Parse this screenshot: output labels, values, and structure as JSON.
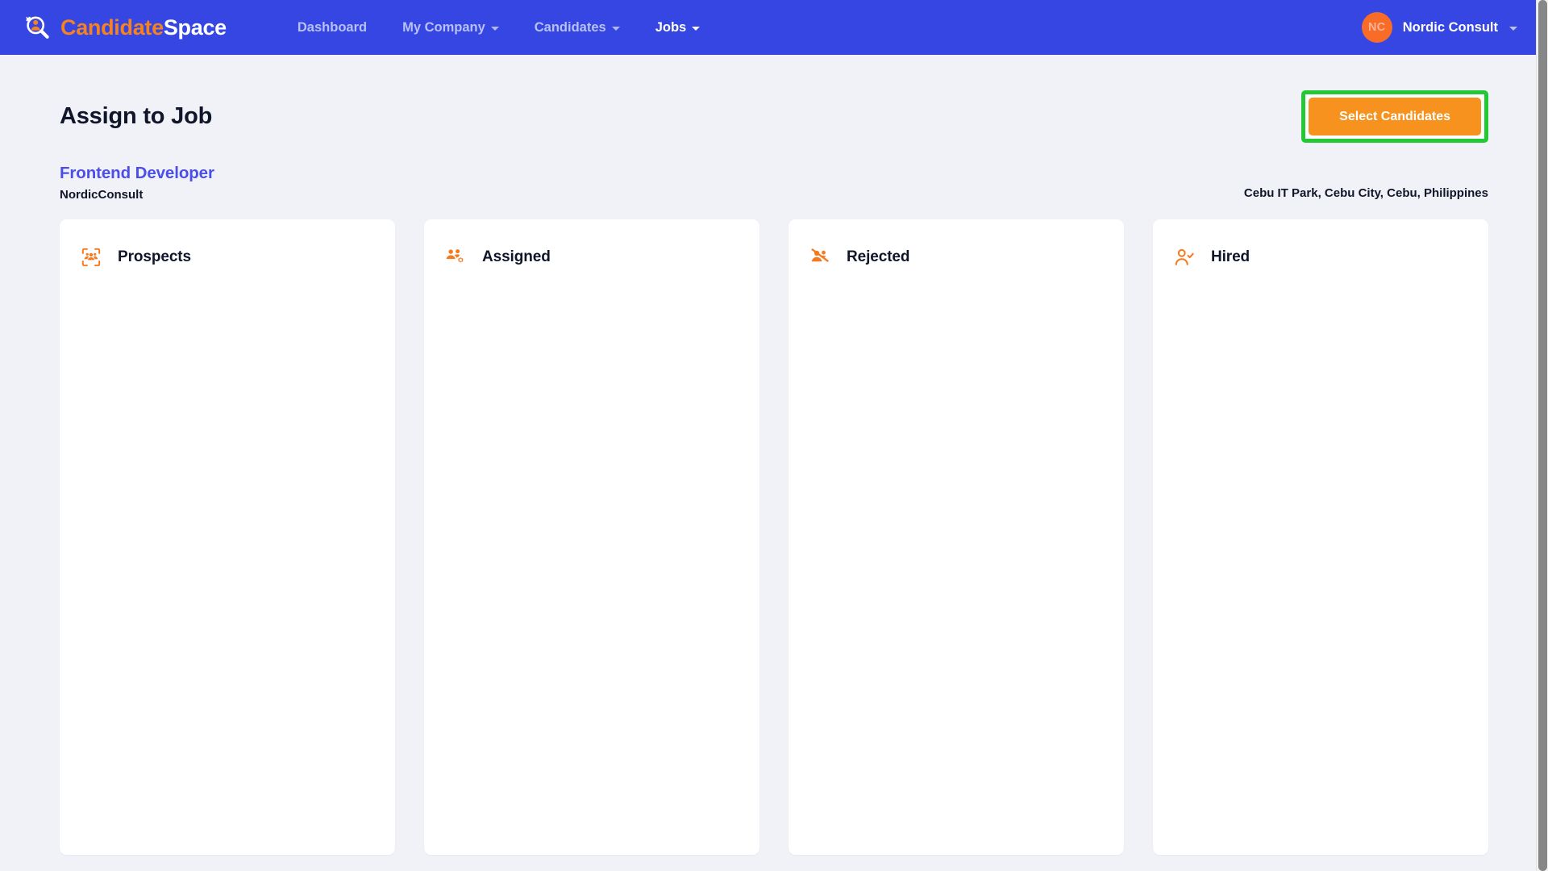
{
  "navbar": {
    "brand": {
      "icon": "candidate-search-logo-icon",
      "text_primary": "Candidate",
      "text_secondary": "Space"
    },
    "links": [
      {
        "label": "Dashboard",
        "has_caret": false,
        "active": false
      },
      {
        "label": "My Company",
        "has_caret": true,
        "active": false
      },
      {
        "label": "Candidates",
        "has_caret": true,
        "active": false
      },
      {
        "label": "Jobs",
        "has_caret": true,
        "active": true
      }
    ],
    "user": {
      "initials": "NC",
      "name": "Nordic Consult"
    }
  },
  "page": {
    "title": "Assign to Job",
    "cta_label": "Select Candidates",
    "job": {
      "title": "Frontend Developer",
      "company": "NordicConsult",
      "location": "Cebu IT Park, Cebu City, Cebu, Philippines"
    }
  },
  "board": {
    "columns": [
      {
        "label": "Prospects",
        "icon": "scan-group-icon",
        "items": []
      },
      {
        "label": "Assigned",
        "icon": "group-gear-icon",
        "items": []
      },
      {
        "label": "Rejected",
        "icon": "group-slash-icon",
        "items": []
      },
      {
        "label": "Hired",
        "icon": "user-check-icon",
        "items": []
      }
    ]
  },
  "colors": {
    "nav_blue": "#3546e3",
    "accent_orange": "#f7921e",
    "icon_orange": "#f7791e",
    "job_title_blue": "#4b4ee8",
    "highlight_green": "#22c935",
    "page_bg": "#f1f2f7"
  }
}
